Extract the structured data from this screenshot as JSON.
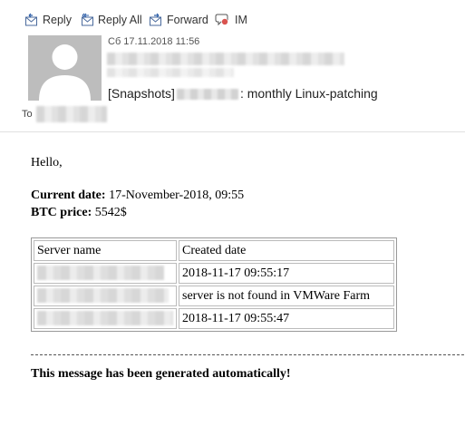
{
  "toolbar": {
    "reply": "Reply",
    "reply_all": "Reply All",
    "forward": "Forward",
    "im": "IM"
  },
  "header": {
    "date": "Сб 17.11.2018 11:56",
    "subject_prefix": "[Snapshots]",
    "subject_suffix": ": monthly Linux-patching",
    "to_label": "To"
  },
  "message": {
    "greeting": "Hello,",
    "current_date_label": "Current date:",
    "current_date_value": " 17-November-2018, 09:55",
    "btc_label": "BTC price:",
    "btc_value": " 5542$",
    "table": {
      "headers": [
        "Server name",
        "Created date"
      ],
      "rows": [
        {
          "created": "2018-11-17 09:55:17"
        },
        {
          "created": "server is not found in VMWare Farm"
        },
        {
          "created": "2018-11-17 09:55:47"
        }
      ]
    },
    "footer": "This message has been generated automatically!"
  }
}
